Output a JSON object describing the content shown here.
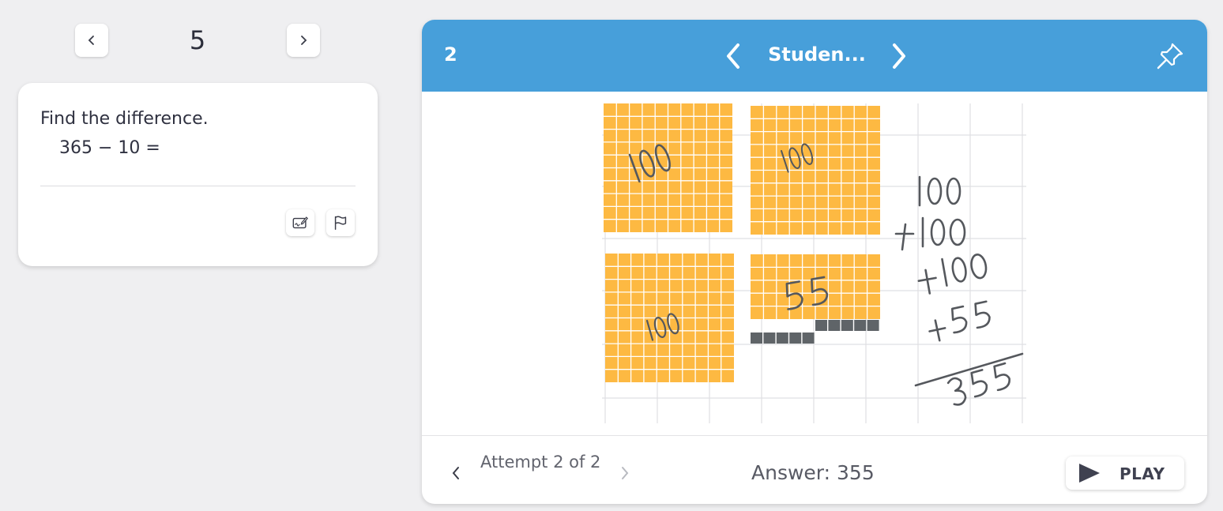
{
  "question_nav": {
    "number": "5"
  },
  "question": {
    "prompt": "Find the difference.",
    "expression": "365 − 10 ="
  },
  "panel": {
    "number": "2",
    "student_name": "Studen...",
    "attempt_text": "Attempt 2 of 2",
    "answer_text": "Answer: 355",
    "play_label": "PLAY"
  },
  "work": {
    "block_labels": [
      "100",
      "100",
      "100",
      "55"
    ],
    "sum_lines": [
      "100",
      "+100",
      "+100",
      "+55",
      "355"
    ]
  },
  "colors": {
    "header": "#479fda",
    "block": "#fdb942",
    "tens_removed": "#5f6468"
  }
}
